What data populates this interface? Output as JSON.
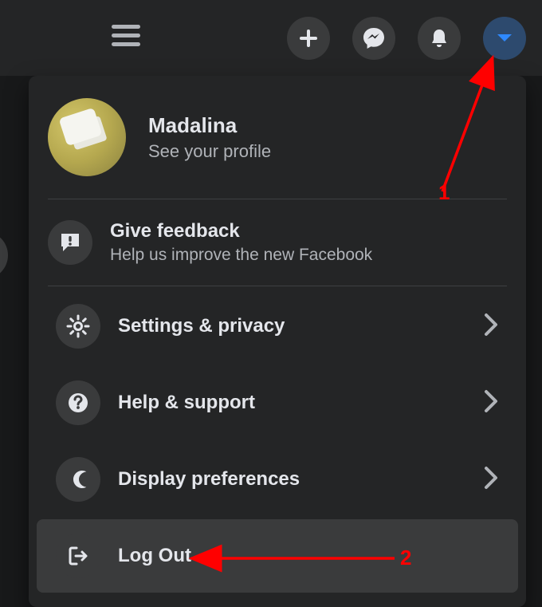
{
  "profile": {
    "name": "Madalina",
    "subtitle": "See your profile"
  },
  "feedback": {
    "title": "Give feedback",
    "subtitle": "Help us improve the new Facebook"
  },
  "menu": {
    "settings": "Settings & privacy",
    "help": "Help & support",
    "display": "Display preferences",
    "logout": "Log Out"
  },
  "annotations": {
    "one": "1",
    "two": "2"
  }
}
